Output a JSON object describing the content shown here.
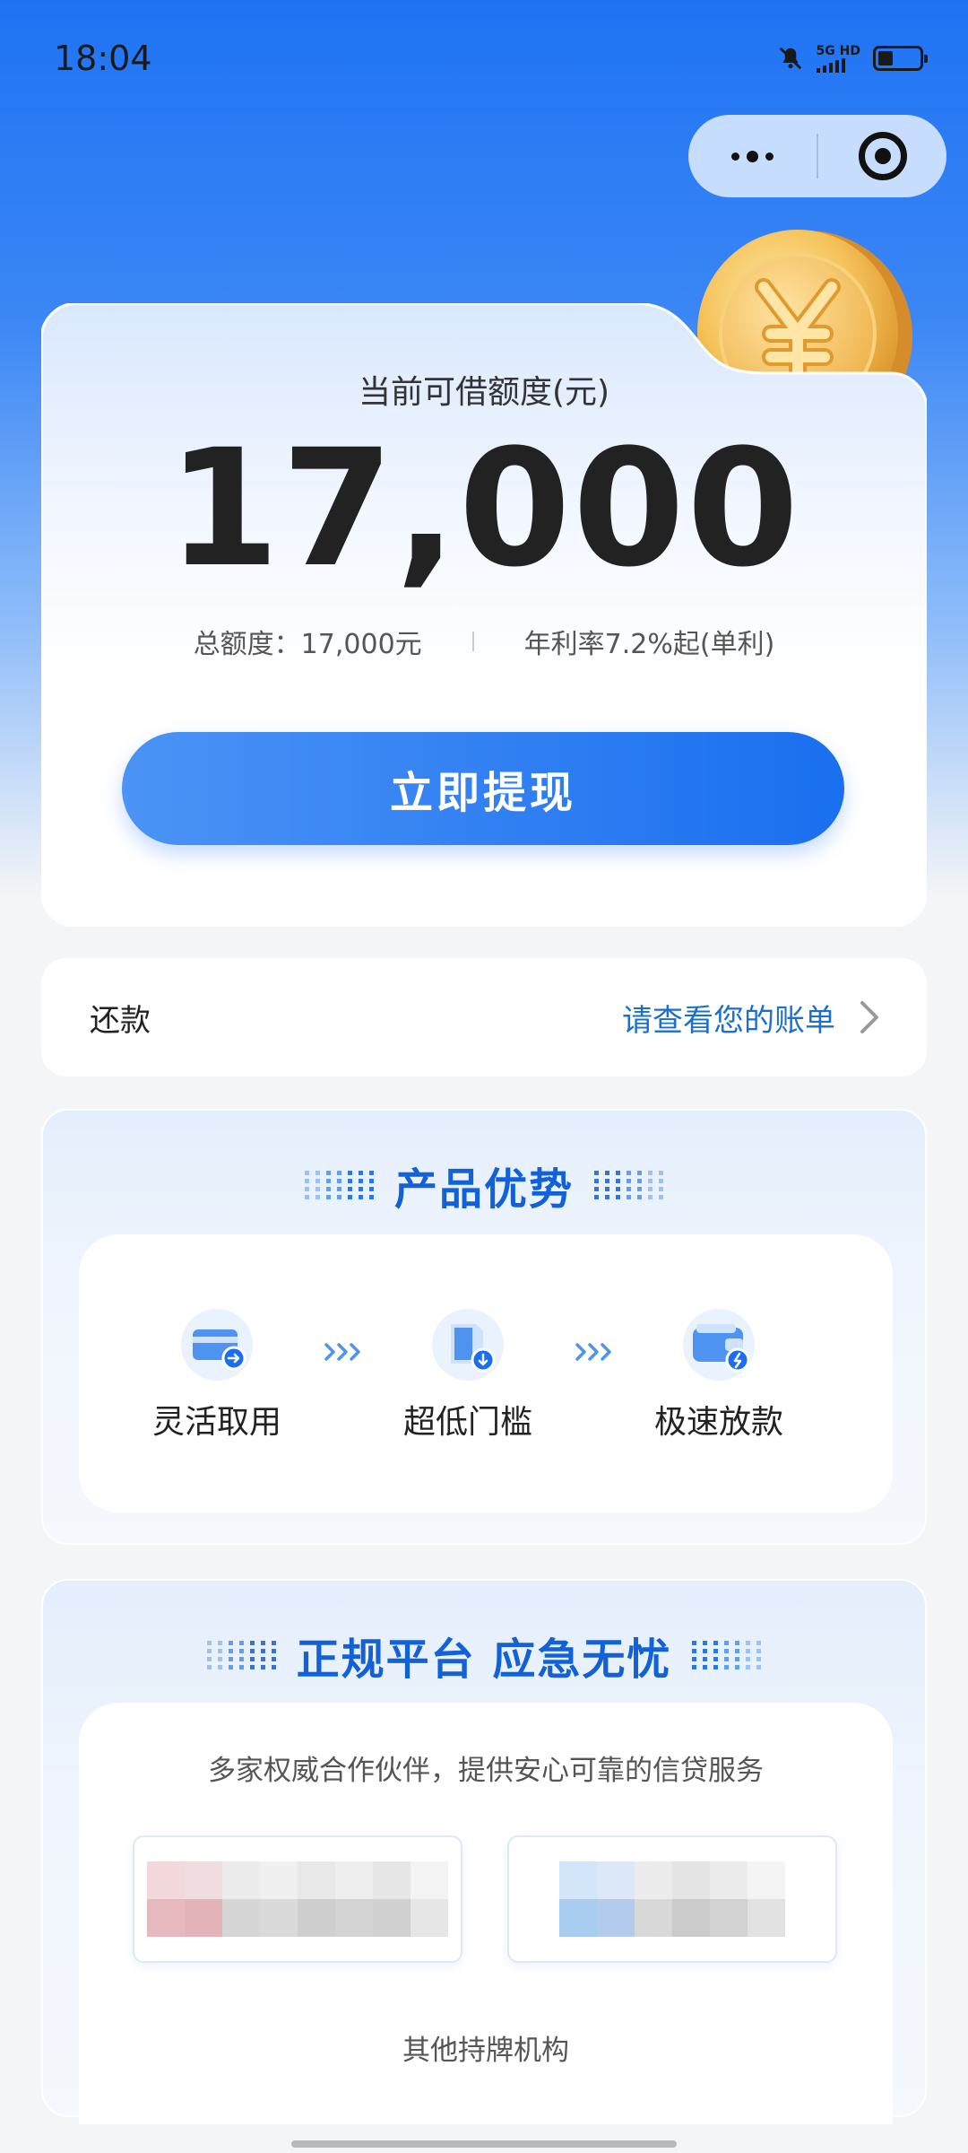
{
  "status_bar": {
    "time": "18:04",
    "network": "5G HD"
  },
  "credit": {
    "title": "当前可借额度(元)",
    "amount": "17,000",
    "total_label": "总额度：17,000元",
    "rate_label": "年利率7.2%起(单利)",
    "withdraw_label": "立即提现"
  },
  "repay": {
    "label": "还款",
    "link_text": "请查看您的账单"
  },
  "advantages": {
    "title": "产品优势",
    "items": [
      {
        "label": "灵活取用",
        "icon": "card-icon"
      },
      {
        "label": "超低门槛",
        "icon": "document-icon"
      },
      {
        "label": "极速放款",
        "icon": "wallet-icon"
      }
    ]
  },
  "platform": {
    "title": "正规平台 应急无忧",
    "description": "多家权威合作伙伴，提供安心可靠的信贷服务",
    "footer": "其他持牌机构"
  },
  "colors": {
    "primary": "#1a6ff0",
    "title_blue": "#1361d6",
    "link_blue": "#1a6fcf"
  }
}
